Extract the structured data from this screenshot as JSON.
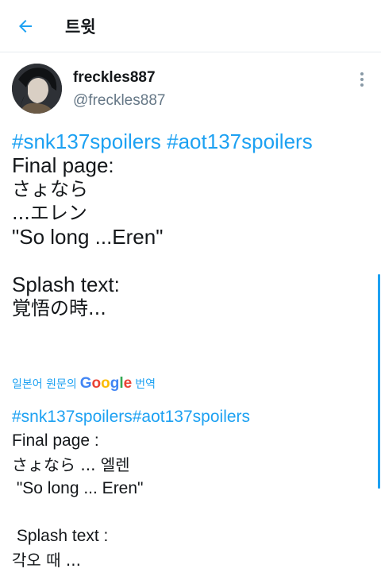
{
  "header": {
    "title": "트윗",
    "back_icon": "arrow-left-icon"
  },
  "tweet": {
    "display_name": "freckles887",
    "handle": "@freckles887",
    "more_icon": "more-vertical-icon",
    "hashtag_1": "#snk137spoilers",
    "hashtag_2": "#aot137spoilers",
    "lines": [
      "Final page:",
      "さょなら",
      "...エレン",
      "\"So long ...Eren\"",
      "Splash text:",
      "覚悟の時..."
    ]
  },
  "translate": {
    "prefix": "일본어 원문의",
    "suffix": "번역"
  },
  "translation": {
    "hashtags": "#snk137spoilers#aot137spoilers",
    "lines": [
      "Final page :",
      "さょなら ... 엘렌",
      " \"So long ... Eren\"",
      " Splash text :",
      "각오 때 ..."
    ]
  },
  "colors": {
    "accent": "#1da1f2",
    "text": "#14171a",
    "muted": "#657786"
  }
}
